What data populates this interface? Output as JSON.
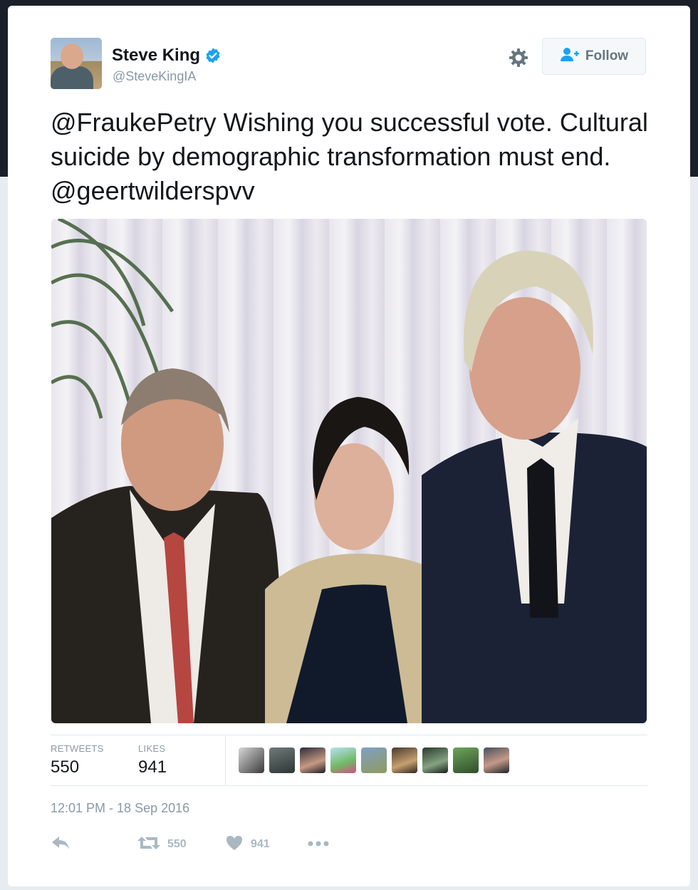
{
  "author": {
    "name": "Steve King",
    "handle": "@SteveKingIA",
    "verified": true,
    "avatar_icon": "profile-photo"
  },
  "follow_button": {
    "label": "Follow",
    "icon": "add-user-icon"
  },
  "settings_icon": "gear-icon",
  "tweet": {
    "mention1": "@FraukePetry",
    "body": " Wishing you successful vote. Cultural suicide by demographic transformation must end. ",
    "mention2": "@geertwilderspvv"
  },
  "photo": {
    "description_icon": "tweet-photo"
  },
  "stats": {
    "retweets_label": "RETWEETS",
    "retweets_value": "550",
    "likes_label": "LIKES",
    "likes_value": "941"
  },
  "timestamp": "12:01 PM - 18 Sep 2016",
  "actions": {
    "reply_icon": "reply-icon",
    "retweet_icon": "retweet-icon",
    "retweet_count": "550",
    "like_icon": "heart-icon",
    "like_count": "941",
    "more_icon": "more-icon"
  },
  "colors": {
    "accent": "#1da1f2",
    "text": "#14171a",
    "muted": "#8899a6",
    "icon_muted": "#aab8c2"
  }
}
